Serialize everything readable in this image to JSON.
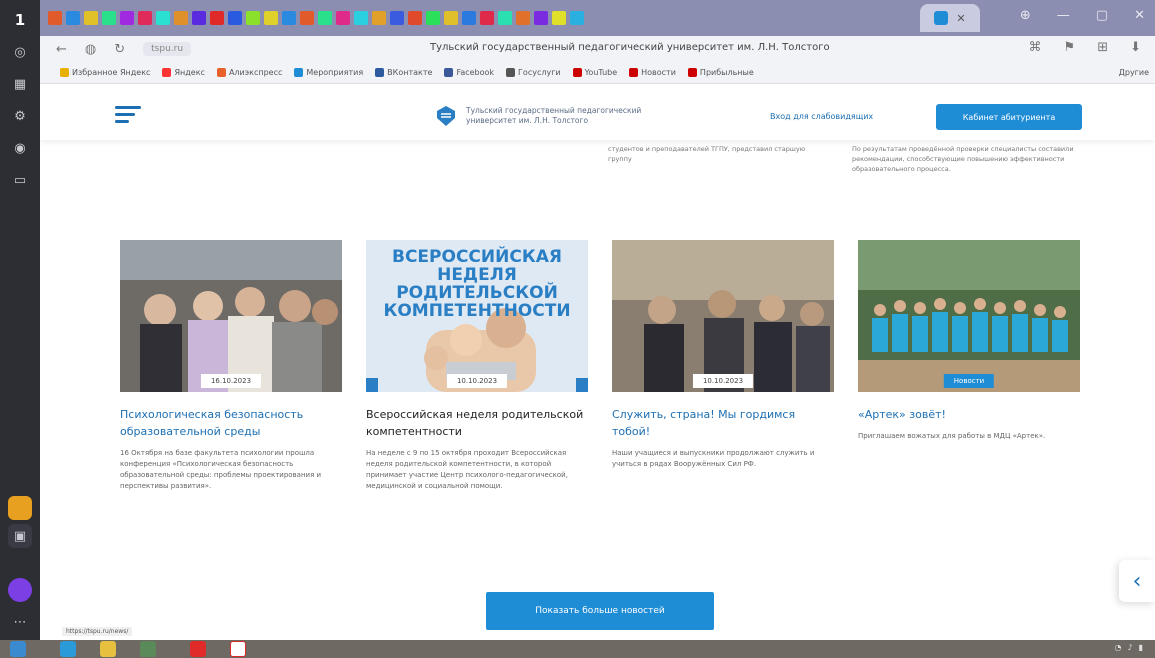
{
  "dock": {
    "badge": "1"
  },
  "browser": {
    "page_title": "Тульский государственный педагогический университет им. Л.Н. Толстого",
    "url_placeholder": "tspu.ru",
    "bookmarks": [
      {
        "label": "Избранное Яндекс",
        "color": "#e8b100"
      },
      {
        "label": "Яндекс",
        "color": "#ff3333"
      },
      {
        "label": "Алиэкспресс",
        "color": "#e8612c"
      },
      {
        "label": "Мероприятия",
        "color": "#1f8dd6"
      },
      {
        "label": "ВКонтакте",
        "color": "#2b5a9e"
      },
      {
        "label": "Facebook",
        "color": "#3b5998"
      },
      {
        "label": "Госуслуги",
        "color": "#555555"
      },
      {
        "label": "YouTube",
        "color": "#cc0000"
      },
      {
        "label": "Новости",
        "color": "#cc0000"
      },
      {
        "label": "Прибыльные",
        "color": "#cc0000"
      }
    ],
    "bookmarks_more": "Другие",
    "status_url": "https://tspu.ru/news/"
  },
  "site": {
    "uni_name": "Тульский государственный педагогический университет им. Л.Н. Толстого",
    "header_link": "Вход для слабовидящих",
    "cabinet_button": "Кабинет абитуриента",
    "prev_text_1": "студентов и преподавателей ТГПУ, представил старшую группу",
    "prev_text_2": "По результатам проведённой проверки специалисты составили рекомендации, способствующие повышению эффективности образовательного процесса.",
    "more_button": "Показать больше новостей"
  },
  "news": [
    {
      "date": "16.10.2023",
      "title": "Психологическая безопасность образовательной среды",
      "desc": "16 Октября на базе факультета психологии прошла конференция «Психологическая безопасность образовательной среды: проблемы проектирования и перспективы развития».",
      "title_style": "link"
    },
    {
      "date": "10.10.2023",
      "title": "Всероссийская неделя родительской компетентности",
      "desc": "На неделе с 9 по 15 октября проходит Всероссийская неделя родительской компетентности, в которой принимает участие Центр психолого-педагогической, медицинской и социальной помощи.",
      "title_style": "dark",
      "banner": "ВСЕРОССИЙСКАЯ НЕДЕЛЯ РОДИТЕЛЬСКОЙ КОМПЕТЕНТНОСТИ"
    },
    {
      "date": "10.10.2023",
      "title": "Служить, страна! Мы гордимся тобой!",
      "desc": "Наши учащиеся и выпускники продолжают служить и учиться в рядах Вооружённых Сил РФ.",
      "title_style": "link"
    },
    {
      "date": "Новости",
      "title": "«Артек» зовёт!",
      "desc": "Приглашаем вожатых для работы в МДЦ «Артек».",
      "title_style": "link",
      "date_is_tag": true
    }
  ]
}
